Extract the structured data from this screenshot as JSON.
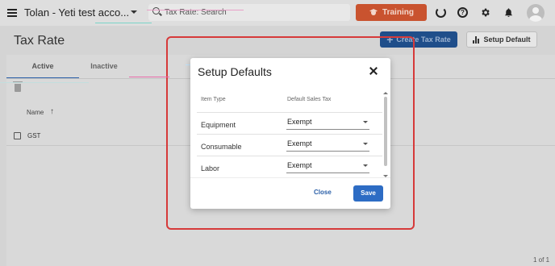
{
  "topbar": {
    "account_name": "Tolan - Yeti test acco...",
    "search_placeholder": "Tax Rate: Search",
    "training_label": "Training",
    "help_glyph": "?"
  },
  "header": {
    "title": "Tax Rate",
    "create_label": "Create Tax Rate",
    "setup_default_label": "Setup Default"
  },
  "tabs": [
    {
      "label": "Active"
    },
    {
      "label": "Inactive"
    }
  ],
  "table": {
    "column_name": "Name",
    "sort_glyph": "↑",
    "rows": [
      {
        "name": "GST"
      }
    ],
    "pager": "1 of 1"
  },
  "dialog": {
    "title": "Setup Defaults",
    "col_item_type": "Item Type",
    "col_default_sales_tax": "Default Sales Tax",
    "rows": [
      {
        "item_type": "Equipment",
        "tax": "Exempt"
      },
      {
        "item_type": "Consumable",
        "tax": "Exempt"
      },
      {
        "item_type": "Labor",
        "tax": "Exempt"
      }
    ],
    "close_label": "Close",
    "save_label": "Save"
  },
  "colors": {
    "training": "#c9532f",
    "primary": "#1f4e8a",
    "save": "#2d6cc4",
    "annotation": "#d63a3a"
  },
  "icons": [
    "hamburger-icon",
    "chevron-down-icon",
    "search-icon",
    "graduation-cap-icon",
    "plus-icon",
    "bar-chart-icon",
    "refresh-icon",
    "help-icon",
    "gear-icon",
    "bell-icon",
    "trash-icon",
    "sort-arrow-icon",
    "close-icon"
  ]
}
